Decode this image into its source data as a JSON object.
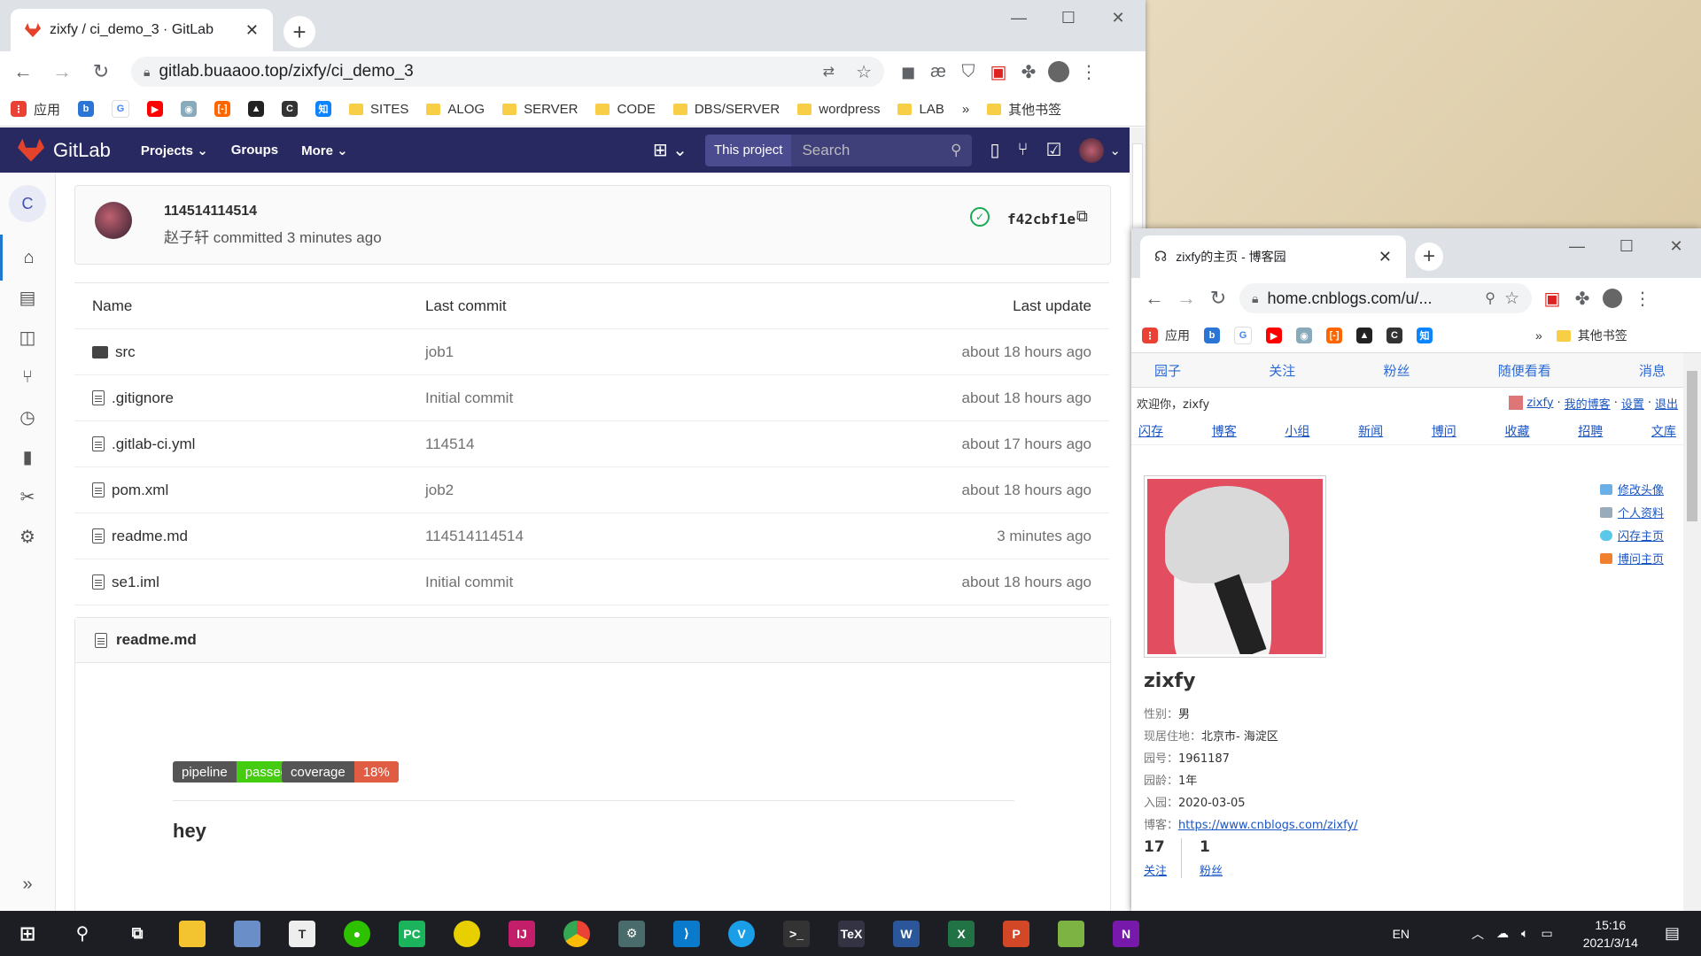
{
  "gitlab_window": {
    "tab_title": "zixfy / ci_demo_3 · GitLab",
    "url": "gitlab.buaaoo.top/zixfy/ci_demo_3",
    "bookmarks": [
      "应用",
      "SITES",
      "ALOG",
      "SERVER",
      "CODE",
      "DBS/SERVER",
      "wordpress",
      "LAB",
      "»",
      "其他书签"
    ],
    "nav": {
      "brand": "GitLab",
      "menu": [
        "Projects ⌄",
        "Groups",
        "More ⌄"
      ],
      "search_scope": "This project",
      "search_placeholder": "Search"
    },
    "sidebar_letter": "C",
    "commit": {
      "title": "114514114514",
      "subtitle": "赵子轩 committed 3 minutes ago",
      "sha": "f42cbf1e"
    },
    "tree": {
      "headers": {
        "name": "Name",
        "commit": "Last commit",
        "update": "Last update"
      },
      "rows": [
        {
          "name": "src",
          "type": "dir",
          "commit": "job1",
          "update": "about 18 hours ago"
        },
        {
          "name": ".gitignore",
          "type": "file",
          "commit": "Initial commit",
          "update": "about 18 hours ago"
        },
        {
          "name": ".gitlab-ci.yml",
          "type": "file",
          "commit": "114514",
          "update": "about 17 hours ago"
        },
        {
          "name": "pom.xml",
          "type": "file",
          "commit": "job2",
          "update": "about 18 hours ago"
        },
        {
          "name": "readme.md",
          "type": "file",
          "commit": "114514114514",
          "update": "3 minutes ago"
        },
        {
          "name": "se1.iml",
          "type": "file",
          "commit": "Initial commit",
          "update": "about 18 hours ago"
        }
      ]
    },
    "readme": {
      "filename": "readme.md",
      "badge_pipeline": {
        "label": "pipeline",
        "value": "passed",
        "color": "#4c1"
      },
      "badge_coverage": {
        "label": "coverage",
        "value": "18%",
        "color": "#e05d44"
      },
      "heading": "hey"
    }
  },
  "cnblogs_window": {
    "tab_title": "zixfy的主页 - 博客园",
    "url": "home.cnblogs.com/u/...",
    "bookmarks": [
      "应用",
      "»",
      "其他书签"
    ],
    "topnav": [
      "园子",
      "关注",
      "粉丝",
      "随便看看",
      "消息"
    ],
    "welcome": "欢迎你，zixfy",
    "user_links": [
      "zixfy",
      "我的博客",
      "设置",
      "退出"
    ],
    "subnav": [
      "闪存",
      "博客",
      "小组",
      "新闻",
      "博问",
      "收藏",
      "招聘",
      "文库"
    ],
    "side_links": [
      "修改头像",
      "个人资料",
      "闪存主页",
      "博问主页"
    ],
    "profile_name": "zixfy",
    "info": [
      {
        "k": "性别：",
        "v": "男"
      },
      {
        "k": "现居住地：",
        "v": "北京市- 海淀区"
      },
      {
        "k": "园号：",
        "v": "1961187"
      },
      {
        "k": "园龄：",
        "v": "1年"
      },
      {
        "k": "入园：",
        "v": "2020-03-05"
      },
      {
        "k": "博客：",
        "v": "https://www.cnblogs.com/zixfy/"
      }
    ],
    "stats": [
      {
        "num": "17",
        "label": "关注"
      },
      {
        "num": "1",
        "label": "粉丝"
      }
    ]
  },
  "taskbar": {
    "lang": "EN",
    "time": "15:16",
    "date": "2021/3/14"
  }
}
